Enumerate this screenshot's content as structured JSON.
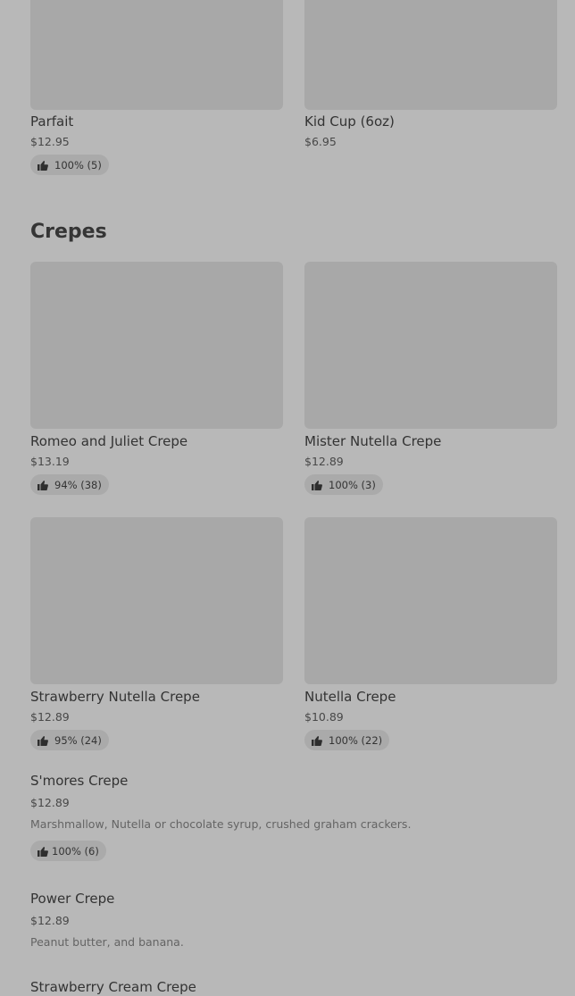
{
  "top_items": [
    {
      "name": "Parfait",
      "price": "$12.95",
      "rating": "100% (5)"
    },
    {
      "name": "Kid Cup (6oz)",
      "price": "$6.95"
    }
  ],
  "section": {
    "title": "Crepes"
  },
  "grid_items": [
    {
      "name": "Romeo and Juliet Crepe",
      "price": "$13.19",
      "rating": "94% (38)"
    },
    {
      "name": "Mister Nutella Crepe",
      "price": "$12.89",
      "rating": "100% (3)"
    },
    {
      "name": "Strawberry Nutella Crepe",
      "price": "$12.89",
      "rating": "95% (24)"
    },
    {
      "name": "Nutella Crepe",
      "price": "$10.89",
      "rating": "100% (22)"
    }
  ],
  "list_items": [
    {
      "name": "S'mores Crepe",
      "price": "$12.89",
      "description": "Marshmallow, Nutella or chocolate syrup, crushed graham crackers.",
      "rating": "100% (6)"
    },
    {
      "name": "Power Crepe",
      "price": "$12.89",
      "description": "Peanut butter, and banana."
    },
    {
      "name": "Strawberry Cream Crepe"
    }
  ],
  "icons": {
    "rating": "thumbs-up-icon"
  },
  "colors": {
    "background": "#b8b8b8",
    "image_placeholder": "#a8a8a8",
    "badge": "#aaaaaa"
  }
}
